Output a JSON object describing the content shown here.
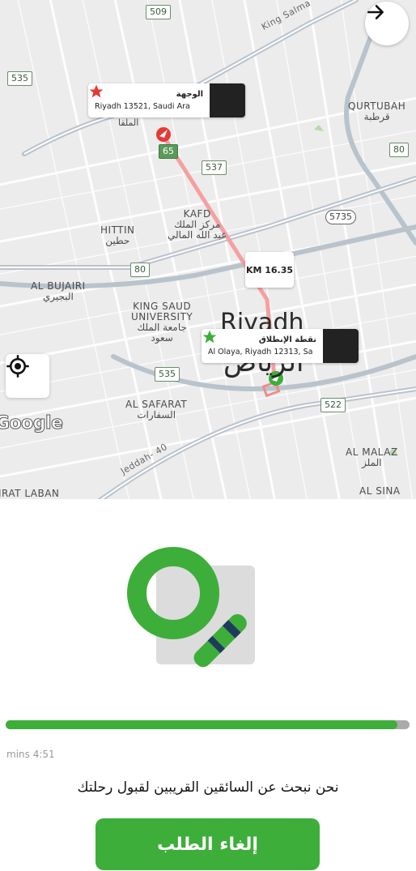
{
  "map": {
    "labels": {
      "qurtubah_en": "QURTUBAH",
      "qurtubah_ar": "قرطبة",
      "kafd_en": "KAFD",
      "kafd_ar1": "مركز الملك",
      "kafd_ar2": "عبد الله المالي",
      "hittin_en": "HITTIN",
      "hittin_ar": "حطين",
      "albujairi_en": "AL BUJAIRI",
      "albujairi_ar": "البجيري",
      "ksu_en1": "KING SAUD",
      "ksu_en2": "UNIVERSITY",
      "ksu_ar1": "جامعة الملك",
      "ksu_ar2": "سعود",
      "alsafarat_en": "AL SAFARAT",
      "alsafarat_ar": "السفارات",
      "almalaz_en": "AL MALAZ",
      "almalaz_ar": "الملز",
      "alsina": "AL SINA",
      "irqah": "IRAT LABAN",
      "almalqa_ar": "الملقا",
      "riyadh_en": "Riyadh",
      "riyadh_ar": "الرياض",
      "road_kingsalman": "King Salma",
      "road_jeddah": "Jeddah- 40"
    },
    "shields": [
      "509",
      "535",
      "80",
      "65",
      "537",
      "5735",
      "80",
      "535",
      "522"
    ],
    "destination": {
      "title": "الوجهة",
      "address": "Riyadh 13521, Saudi Ara"
    },
    "pickup": {
      "title": "نقطة الإنطلاق",
      "address": "Al Olaya, Riyadh 12313, Sa"
    },
    "distance": "KM 16.35",
    "google_logo": "Google"
  },
  "icons": {
    "next": "arrow-right-icon",
    "locate": "my-location-icon",
    "search": "magnifier-illustration"
  },
  "status": {
    "progress": 0.97,
    "timer": "mins 4:51",
    "message": "نحن نبحث عن السائقين القريبين لقبول رحلتك"
  },
  "actions": {
    "cancel_label": "إلغاء الطلب"
  },
  "colors": {
    "accent": "#3dae3a",
    "route": "#f08b8b",
    "dark": "#222222"
  }
}
